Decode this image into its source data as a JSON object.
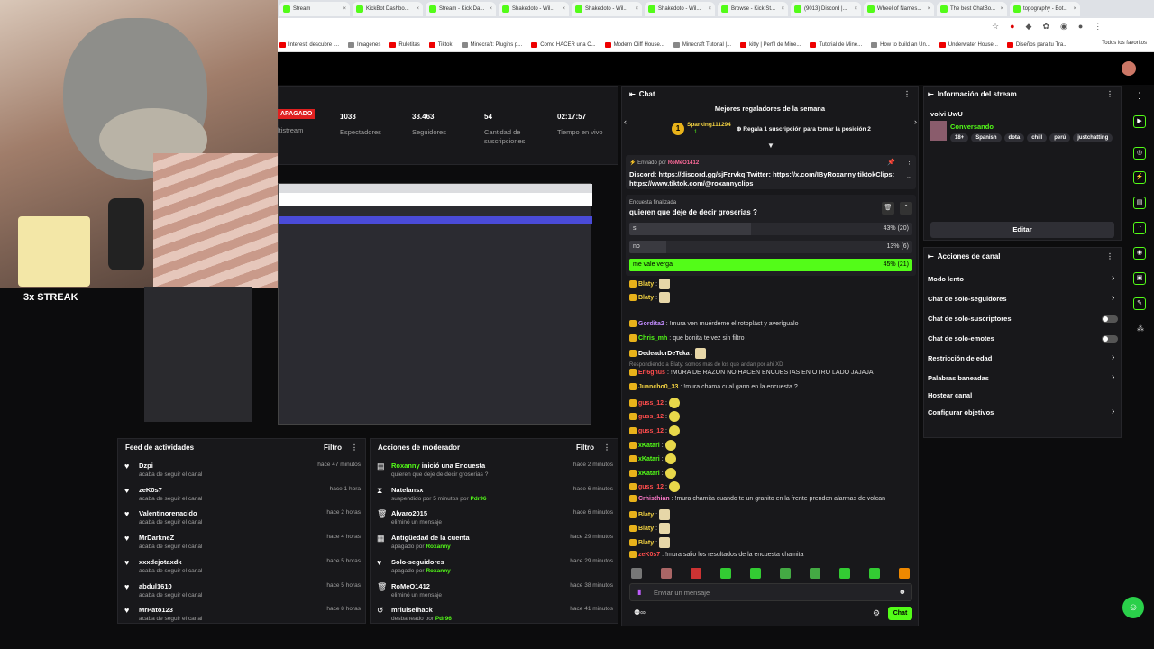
{
  "browser": {
    "tabs": [
      "Stream",
      "KickBot Dashbo...",
      "Stream - Kick Da...",
      "Shakedoto - Wil...",
      "Shakedoto - Wil...",
      "Shakedoto - Wil...",
      "Browse - Kick St...",
      "(9013) Discord |...",
      "Wheel of Names...",
      "The best ChatBo...",
      "topography - Bot..."
    ],
    "bookmarks": [
      "Interest: descubre i...",
      "Imagenes",
      "Ruletitas",
      "Tiktok",
      "Minecraft: Plugins p...",
      "Como HACER una C...",
      "Modern Cliff House...",
      "Minecraft Tutorial |...",
      "kitty | Perfil de Mine...",
      "Tutorial de Mine...",
      "How to build an Un...",
      "Underwater House...",
      "Diseños para tu Tra..."
    ],
    "bookmarks_right": "Todos los favoritos"
  },
  "overlay": {
    "streak": "3x STREAK"
  },
  "stats": {
    "badge": "APAGADO",
    "badge_sub": "ltistream",
    "items": [
      {
        "value": "1033",
        "label": "Espectadores"
      },
      {
        "value": "33.463",
        "label": "Seguidores"
      },
      {
        "value": "54",
        "label": "Cantidad de suscripciones"
      },
      {
        "value": "02:17:57",
        "label": "Tiempo en vivo"
      }
    ]
  },
  "activity": {
    "title": "Feed de actividades",
    "filter": "Filtro",
    "items": [
      {
        "name": "Dzpi",
        "action": "acaba de seguir el canal",
        "time": "hace 47 minutos"
      },
      {
        "name": "zeK0s7",
        "action": "acaba de seguir el canal",
        "time": "hace 1 hora"
      },
      {
        "name": "Valentinorenacido",
        "action": "acaba de seguir el canal",
        "time": "hace 2 horas"
      },
      {
        "name": "MrDarkneZ",
        "action": "acaba de seguir el canal",
        "time": "hace 4 horas"
      },
      {
        "name": "xxxdejotaxdk",
        "action": "acaba de seguir el canal",
        "time": "hace 5 horas"
      },
      {
        "name": "abdul1610",
        "action": "acaba de seguir el canal",
        "time": "hace 5 horas"
      },
      {
        "name": "MrPato123",
        "action": "acaba de seguir el canal",
        "time": "hace 8 horas"
      }
    ]
  },
  "modactions": {
    "title": "Acciones de moderador",
    "filter": "Filtro",
    "items": [
      {
        "icon": "poll",
        "actor": "Roxanny",
        "rest": "inició una Encuesta",
        "sub": "quieren que deje de decir groserias ?",
        "by": "",
        "time": "hace 2 minutos"
      },
      {
        "icon": "hourglass",
        "actor": "",
        "rest": "Natelansx",
        "sub": "suspendido por 5 minutos por",
        "by": "Pdr96",
        "time": "hace 6 minutos"
      },
      {
        "icon": "trash",
        "actor": "",
        "rest": "Alvaro2015",
        "sub": "eliminó un mensaje",
        "by": "",
        "time": "hace 6 minutos"
      },
      {
        "icon": "calendar",
        "actor": "",
        "rest": "Antigüedad de la cuenta",
        "sub": "apagado por",
        "by": "Roxanny",
        "time": "hace 29 minutos"
      },
      {
        "icon": "heart",
        "actor": "",
        "rest": "Solo-seguidores",
        "sub": "apagado por",
        "by": "Roxanny",
        "time": "hace 29 minutos"
      },
      {
        "icon": "trash",
        "actor": "",
        "rest": "RoMeO1412",
        "sub": "eliminó un mensaje",
        "by": "",
        "time": "hace 38 minutos"
      },
      {
        "icon": "undo",
        "actor": "",
        "rest": "mrluiselhack",
        "sub": "desbaneado por",
        "by": "Pdr96",
        "time": "hace 41 minutos"
      }
    ]
  },
  "chat": {
    "title": "Chat",
    "gifters_title": "Mejores regaladores de la semana",
    "top_gifter": "Sparking111294",
    "top_gifter_count": "1",
    "gift_cta": "Regala 1 suscripción para tomar la posición 2",
    "pinned_by_label": "Enviado por",
    "pinned_by": "RoMeO1412",
    "pinned_text_1": "Discord: ",
    "pinned_link_1": "https://discord.gg/sjFzrvkq",
    "pinned_text_2": " Twitter: ",
    "pinned_link_2": "https://x.com/IByRoxanny",
    "pinned_text_3": " tiktokClips:",
    "pinned_link_3": "https://www.tiktok.com/@roxannyclips",
    "poll_state": "Encuesta finalizada",
    "poll_question": "quieren que deje de decir groserias ?",
    "poll_options": [
      {
        "label": "si",
        "result": "43% (20)",
        "pct": 43
      },
      {
        "label": "no",
        "result": "13% (6)",
        "pct": 13
      },
      {
        "label": "me vale verga",
        "result": "45% (21)",
        "pct": 45
      }
    ],
    "messages": [
      {
        "user": "Blaty",
        "color": "#f5d442",
        "text": "",
        "emote": "img"
      },
      {
        "user": "Blaty",
        "color": "#f5d442",
        "text": "",
        "emote": "img"
      },
      {
        "user": "Gordita2",
        "color": "#c28cff",
        "text": "!mura ven muérdeme el rotoplást y averígualo",
        "emote": ""
      },
      {
        "user": "Chris_mh",
        "color": "#53fc18",
        "text": "que bonita te vez sin filtro",
        "emote": ""
      },
      {
        "user": "DedeadorDeTeka",
        "color": "#ffffff",
        "text": "",
        "emote": "img"
      },
      {
        "user": "Eri6gnus",
        "color": "#ff4d4d",
        "text": "!MURA DE RAZON NO HACEN ENCUESTAS EN OTRO LADO JAJAJA",
        "emote": "",
        "reply": "Respondiendo a Blaty: somos mas de los que andan por ahi XD"
      },
      {
        "user": "Juancho0_33",
        "color": "#f5d442",
        "text": "!mura chama cual gano en la encuesta ?",
        "emote": ""
      },
      {
        "user": "guss_12",
        "color": "#ff4d4d",
        "text": "",
        "emote": "y"
      },
      {
        "user": "guss_12",
        "color": "#ff4d4d",
        "text": "",
        "emote": "y"
      },
      {
        "user": "guss_12",
        "color": "#ff4d4d",
        "text": "",
        "emote": "y"
      },
      {
        "user": "xKatari",
        "color": "#53fc18",
        "text": "",
        "emote": "y"
      },
      {
        "user": "xKatari",
        "color": "#53fc18",
        "text": "",
        "emote": "y"
      },
      {
        "user": "xKatari",
        "color": "#53fc18",
        "text": "",
        "emote": "y"
      },
      {
        "user": "guss_12",
        "color": "#ff4d4d",
        "text": "",
        "emote": "y"
      },
      {
        "user": "Crhisthian",
        "color": "#ff7acb",
        "text": "!mura chamita cuando te un granito en la frente prenden alarmas de volcan",
        "emote": ""
      },
      {
        "user": "Blaty",
        "color": "#f5d442",
        "text": "",
        "emote": "img"
      },
      {
        "user": "Blaty",
        "color": "#f5d442",
        "text": "",
        "emote": "img"
      },
      {
        "user": "Blaty",
        "color": "#f5d442",
        "text": "",
        "emote": "img"
      },
      {
        "user": "zeK0s7",
        "color": "#ff4d4d",
        "text": "!mura salio los resultados de la encuesta chamita",
        "emote": ""
      }
    ],
    "input_placeholder": "Enviar un mensaje",
    "send_label": "Chat"
  },
  "stream_info": {
    "title": "Información del stream",
    "stream_title": "volvi UwU",
    "category": "Conversando",
    "tags": [
      "18+",
      "Spanish",
      "dota",
      "chill",
      "perú",
      "justchatting"
    ],
    "edit_label": "Editar"
  },
  "channel_actions": {
    "title": "Acciones de canal",
    "items": [
      {
        "label": "Modo lento",
        "control": "chevron"
      },
      {
        "label": "Chat de solo-seguidores",
        "control": "chevron"
      },
      {
        "label": "Chat de solo-suscriptores",
        "control": "toggle"
      },
      {
        "label": "Chat de solo-emotes",
        "control": "toggle"
      },
      {
        "label": "Restricción de edad",
        "control": "chevron"
      },
      {
        "label": "Palabras baneadas",
        "control": "chevron"
      },
      {
        "label": "Hostear canal",
        "control": "none"
      },
      {
        "label": "Configurar objetivos",
        "control": "chevron"
      }
    ]
  },
  "colors": {
    "accent": "#53fc18",
    "panel": "#18181b",
    "page": "#0c0c0d"
  }
}
